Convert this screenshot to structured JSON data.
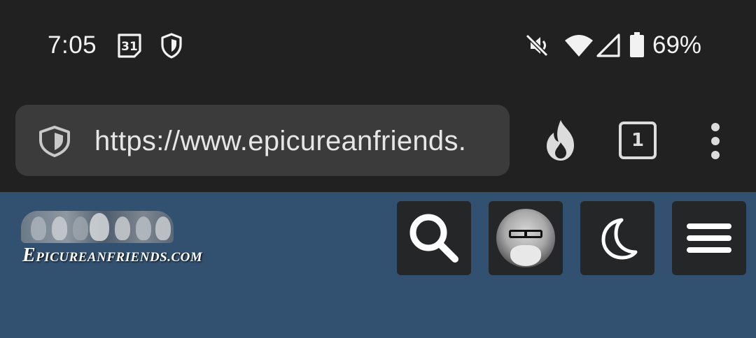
{
  "status_bar": {
    "time": "7:05",
    "calendar_day": "31",
    "battery": "69%",
    "icons": [
      "calendar-icon",
      "shield-icon",
      "mute-icon",
      "wifi-icon",
      "signal-icon",
      "battery-icon"
    ]
  },
  "browser": {
    "url": "https://www.epicureanfriends.",
    "tab_count": "1",
    "icons": [
      "site-security-shield-icon",
      "fire-icon",
      "tabs-icon",
      "overflow-menu-icon"
    ]
  },
  "site": {
    "logo_text_initial": "E",
    "logo_text_rest": "PICUREANFRIENDS.COM",
    "buttons": [
      "search-icon",
      "user-avatar",
      "moon-icon",
      "hamburger-menu-icon"
    ],
    "colors": {
      "header_bg": "#32506f",
      "button_bg": "#252628",
      "chrome_bg": "#212121",
      "url_bg": "#3b3b3b"
    }
  }
}
